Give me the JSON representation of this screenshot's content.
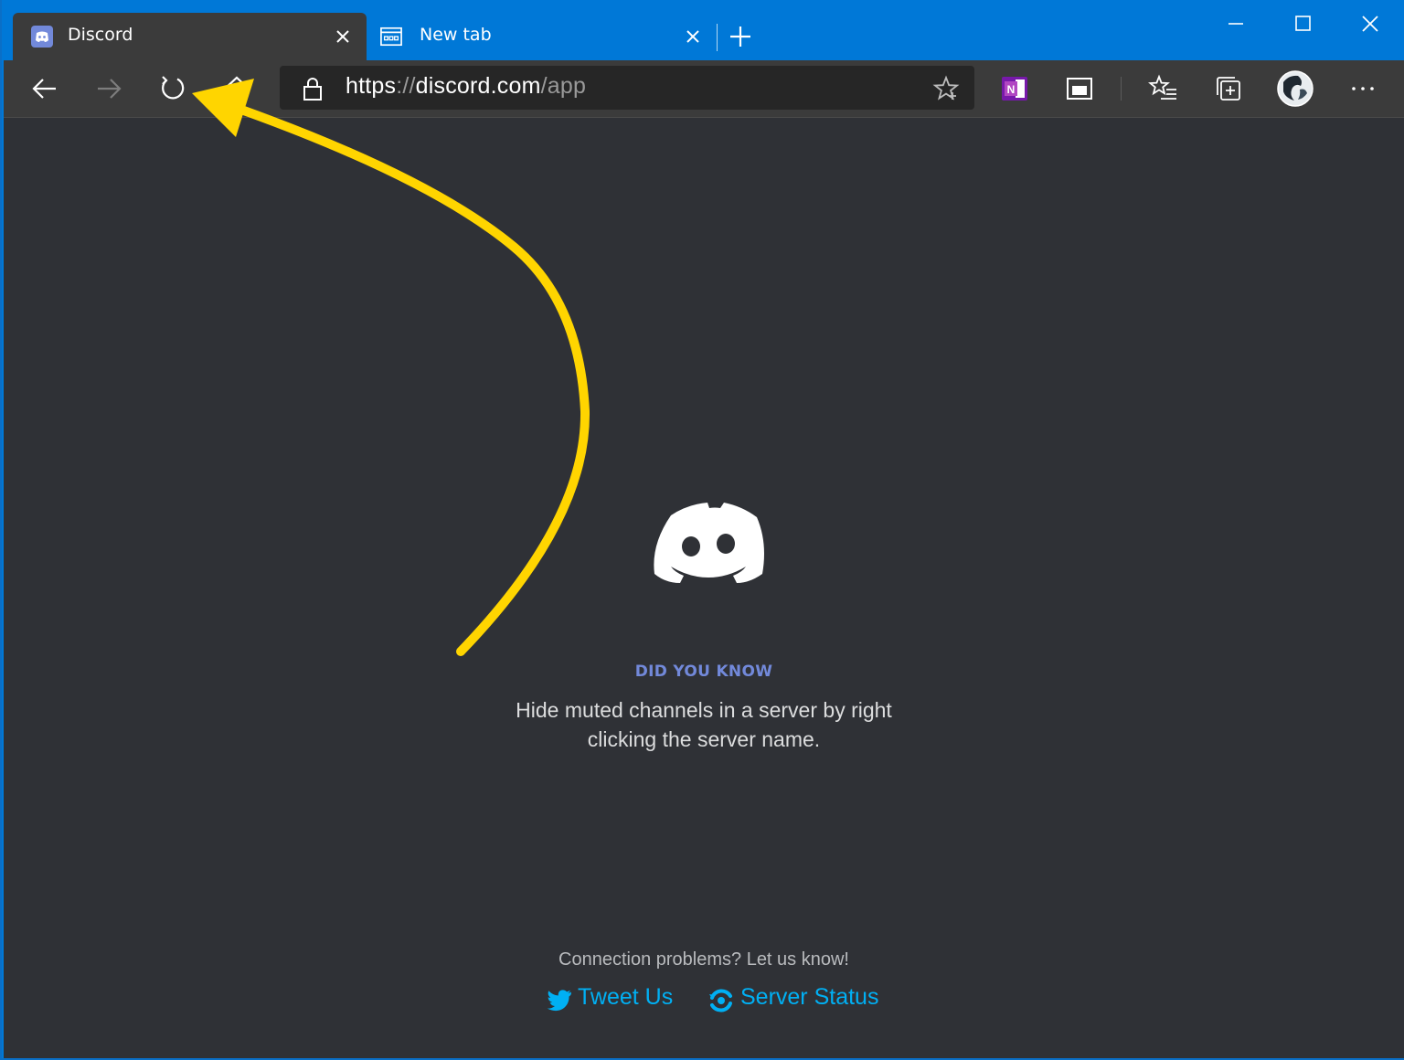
{
  "browser": {
    "tabs": [
      {
        "title": "Discord",
        "favicon": "discord-icon",
        "active": true
      },
      {
        "title": "New tab",
        "favicon": "new-tab-page-icon",
        "active": false
      }
    ],
    "address": {
      "protocol": "https",
      "separator": "://",
      "host": "discord.com",
      "path": "/app"
    },
    "colors": {
      "titlebar": "#0078d7",
      "toolbar": "#3b3b3b",
      "content_bg": "#2f3136"
    }
  },
  "content": {
    "logo": "discord-logo-icon",
    "did_you_know_title": "DID YOU KNOW",
    "tip": "Hide muted channels in a server by right clicking the server name.",
    "connection_text": "Connection problems? Let us know!",
    "tweet_label": "Tweet Us",
    "status_label": "Server Status",
    "colors": {
      "accent": "#7289da",
      "link": "#00b0f4"
    }
  },
  "annotation": {
    "type": "curved-arrow",
    "color": "#ffd500",
    "points_to": "refresh-button"
  }
}
